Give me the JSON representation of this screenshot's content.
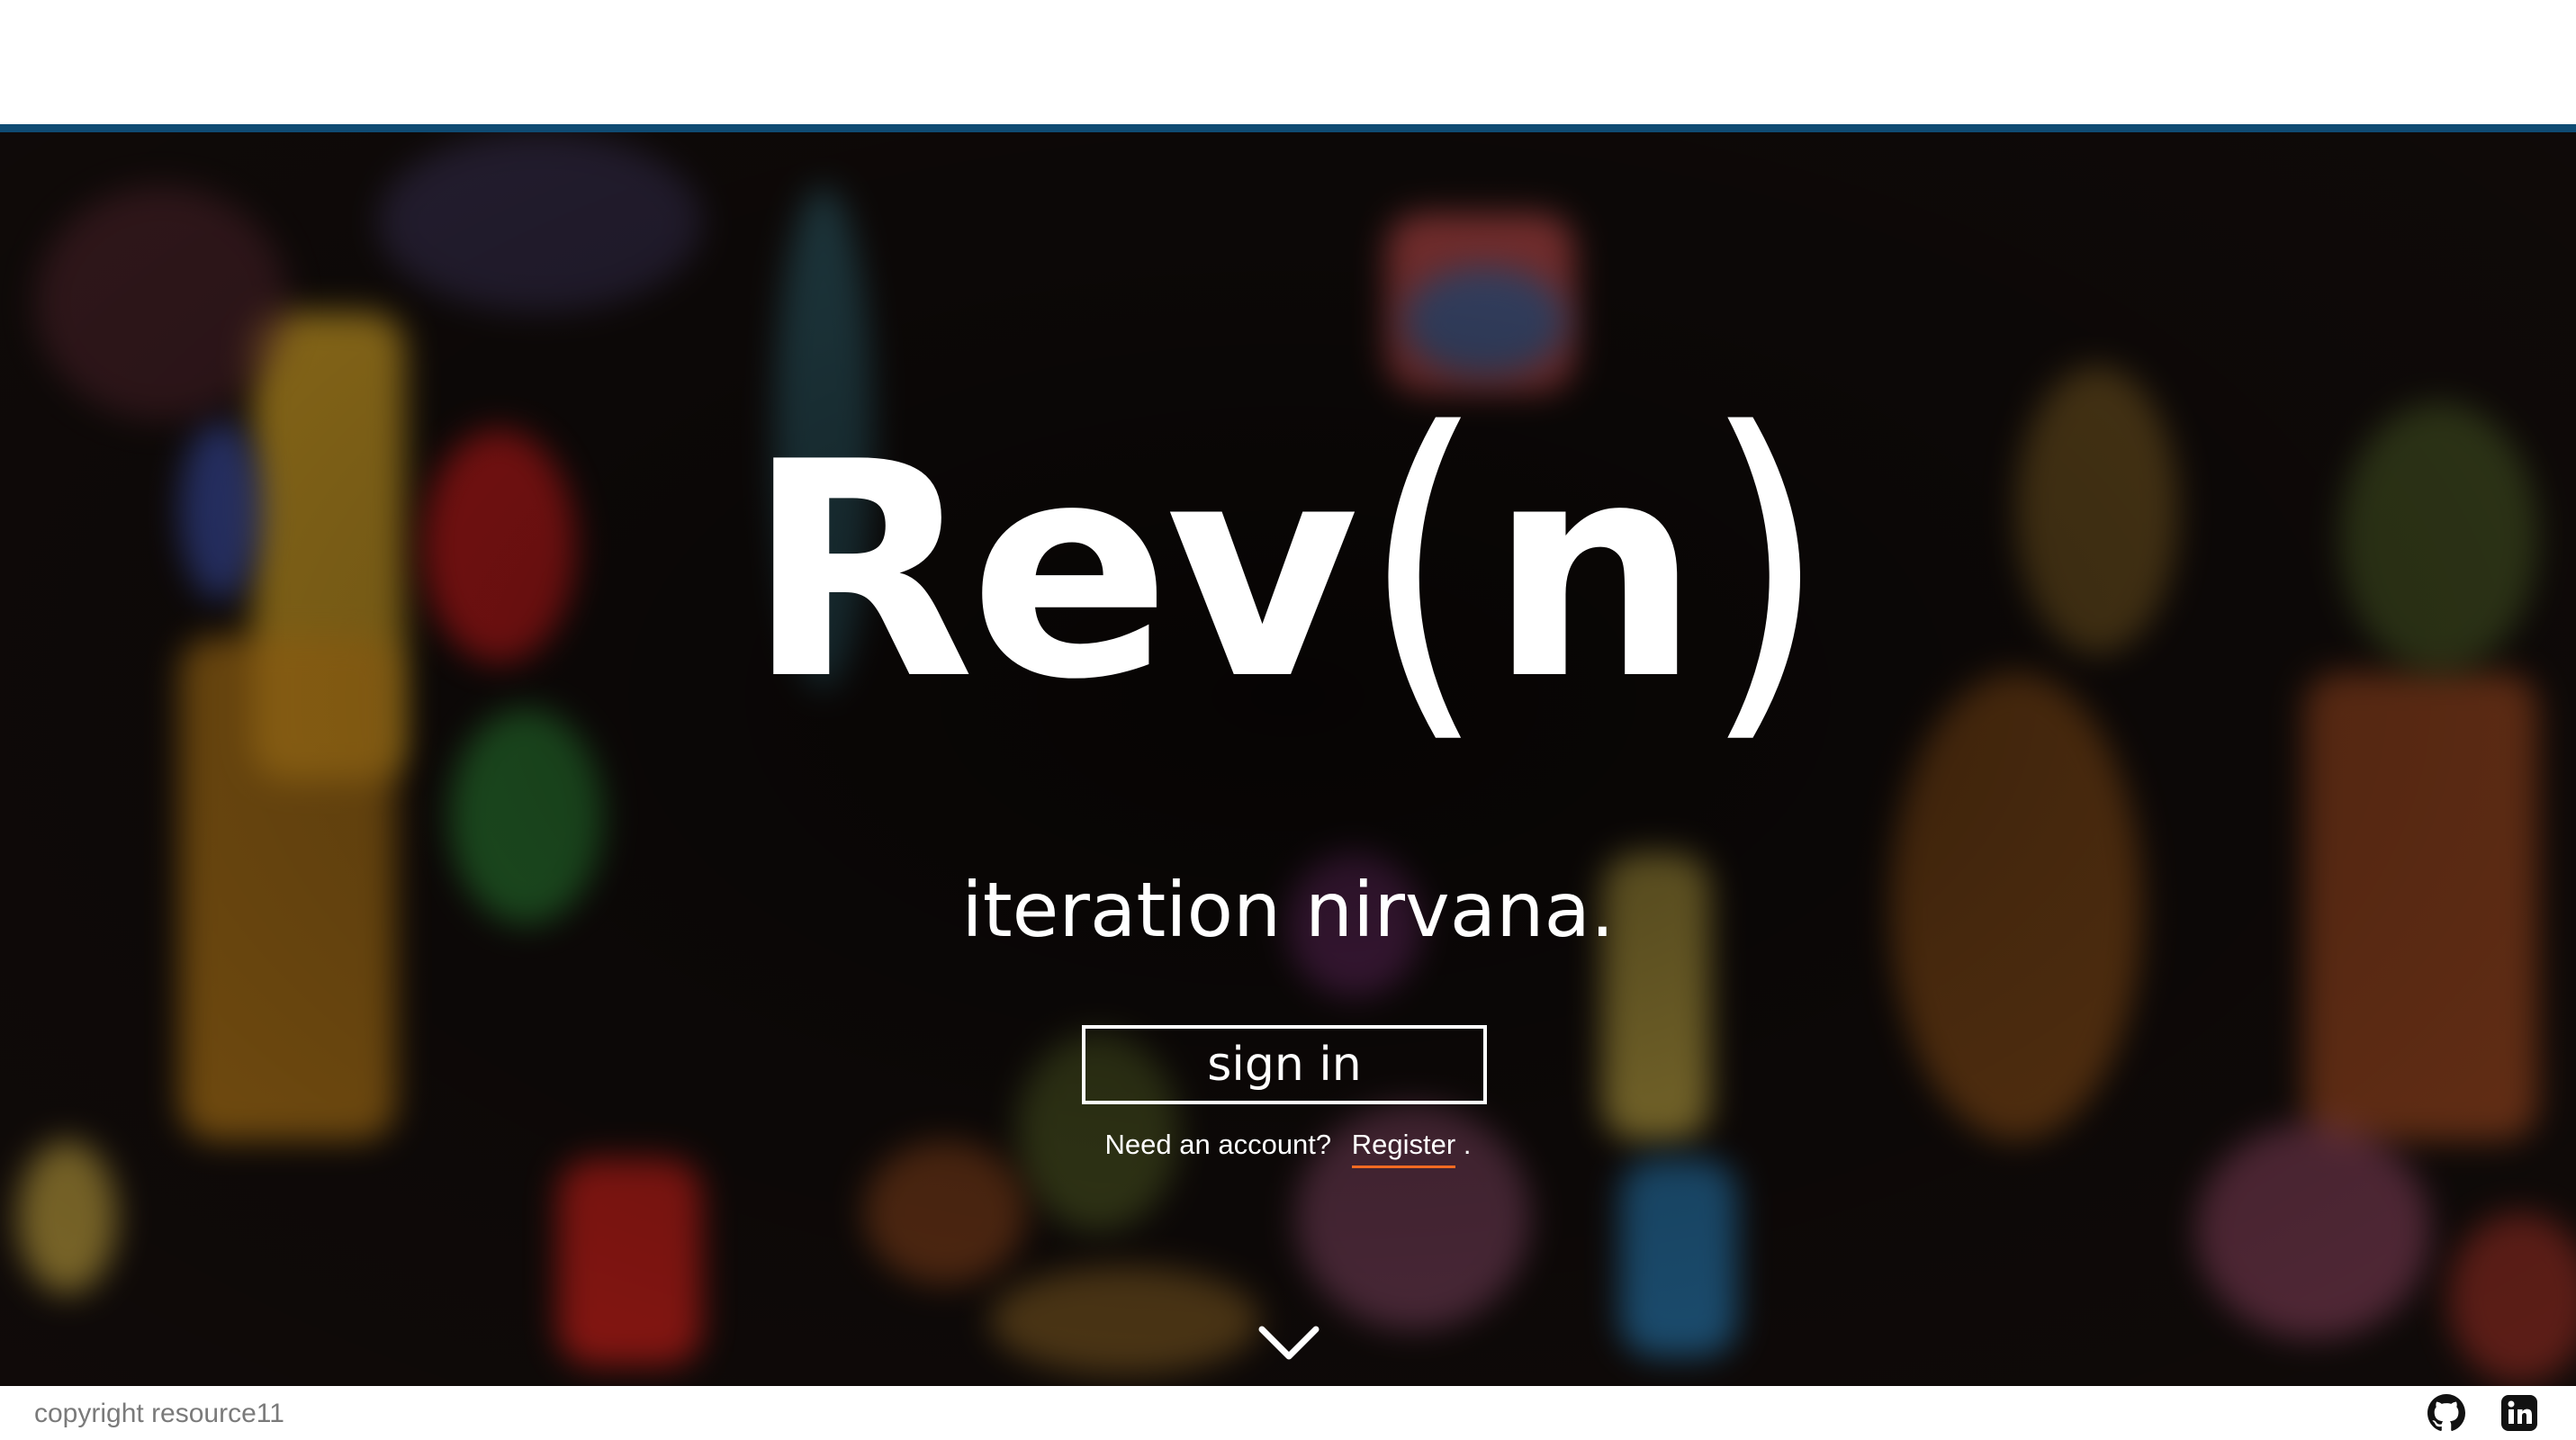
{
  "hero": {
    "logo_main": "Rev",
    "logo_open_paren": "(",
    "logo_letter": "n",
    "logo_close_paren": ")",
    "tagline": "iteration nirvana."
  },
  "auth": {
    "signin_label": "sign in",
    "need_account_text": "Need an account?",
    "register_label": "Register",
    "register_suffix": "."
  },
  "footer": {
    "copyright": "copyright resource11"
  },
  "icons": {
    "scroll": "chevron-down-icon",
    "github": "github-icon",
    "linkedin": "linkedin-icon"
  },
  "colors": {
    "accent_line": "#0f4b73",
    "register_underline": "#f26a22",
    "copyright_text": "#7a7a7a"
  }
}
